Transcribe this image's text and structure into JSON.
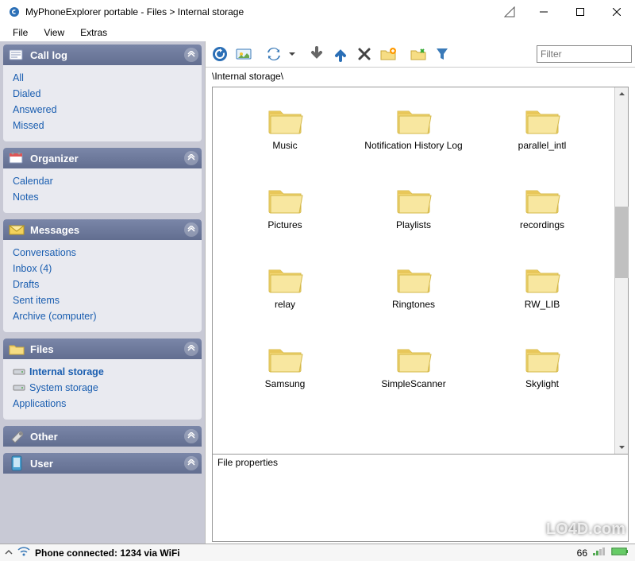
{
  "window": {
    "title": "MyPhoneExplorer portable - Files > Internal storage"
  },
  "menu": {
    "file": "File",
    "view": "View",
    "extras": "Extras"
  },
  "sidebar": {
    "sections": [
      {
        "title": "Call log",
        "items": [
          {
            "label": "All"
          },
          {
            "label": "Dialed"
          },
          {
            "label": "Answered"
          },
          {
            "label": "Missed"
          }
        ]
      },
      {
        "title": "Organizer",
        "items": [
          {
            "label": "Calendar"
          },
          {
            "label": "Notes"
          }
        ]
      },
      {
        "title": "Messages",
        "items": [
          {
            "label": "Conversations"
          },
          {
            "label": "Inbox (4)"
          },
          {
            "label": "Drafts"
          },
          {
            "label": "Sent items"
          },
          {
            "label": "Archive (computer)"
          }
        ]
      },
      {
        "title": "Files",
        "items": [
          {
            "label": "Internal storage",
            "selected": true,
            "icon": "disk"
          },
          {
            "label": "System storage",
            "icon": "disk"
          },
          {
            "label": "Applications"
          }
        ]
      },
      {
        "title": "Other",
        "items": []
      },
      {
        "title": "User",
        "items": []
      }
    ]
  },
  "toolbar": {
    "filter_placeholder": "Filter"
  },
  "breadcrumb": "\\Internal storage\\",
  "folders": [
    "Music",
    "Notification History Log",
    "parallel_intl",
    "Pictures",
    "Playlists",
    "recordings",
    "relay",
    "Ringtones",
    "RW_LIB",
    "Samsung",
    "SimpleScanner",
    "Skylight"
  ],
  "properties_label": "File properties",
  "status": {
    "text": "Phone connected: 1234 via WiFi",
    "signal": "66"
  },
  "watermark": "LO4D.com"
}
